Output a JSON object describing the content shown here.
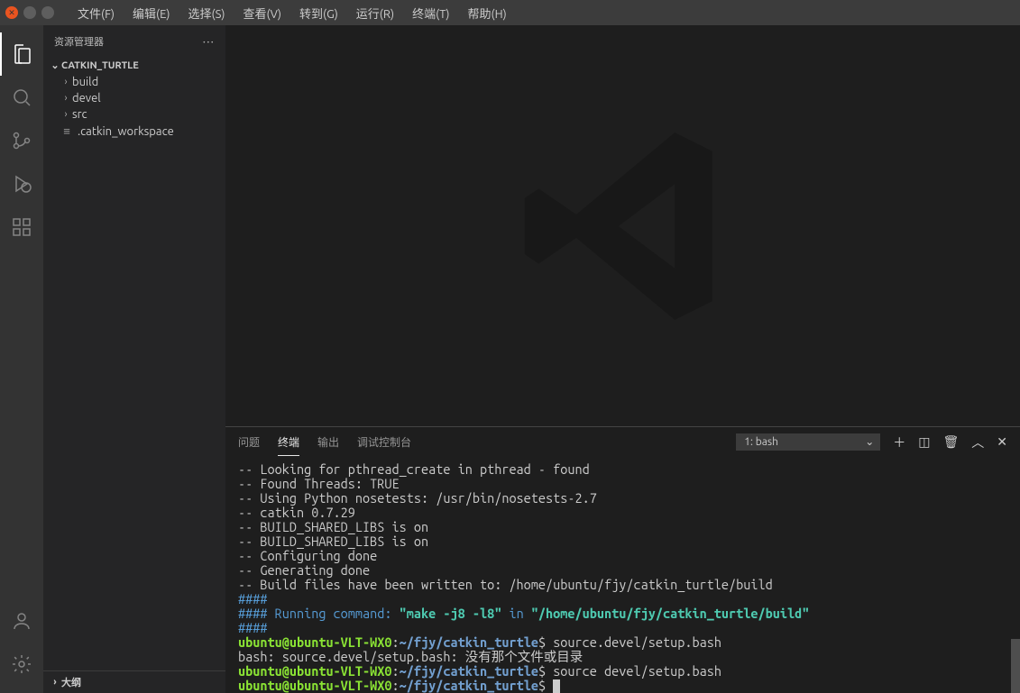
{
  "menu": {
    "file": "文件(F)",
    "edit": "编辑(E)",
    "select": "选择(S)",
    "view": "查看(V)",
    "go": "转到(G)",
    "run": "运行(R)",
    "terminal": "终端(T)",
    "help": "帮助(H)"
  },
  "sidebar": {
    "title": "资源管理器",
    "project": "CATKIN_TURTLE",
    "items": [
      {
        "label": "build"
      },
      {
        "label": "devel"
      },
      {
        "label": "src"
      },
      {
        "label": ".catkin_workspace"
      }
    ],
    "outline": "大纲"
  },
  "panel": {
    "tabs": {
      "problems": "问题",
      "terminal": "终端",
      "output": "输出",
      "debug": "调试控制台"
    },
    "terminalSelect": "1: bash"
  },
  "terminal": {
    "l1": "-- Looking for pthread_create in pthread - found",
    "l2": "-- Found Threads: TRUE",
    "l3": "-- Using Python nosetests: /usr/bin/nosetests-2.7",
    "l4": "-- catkin 0.7.29",
    "l5": "-- BUILD_SHARED_LIBS is on",
    "l6": "-- BUILD_SHARED_LIBS is on",
    "l7": "-- Configuring done",
    "l8": "-- Generating done",
    "l9": "-- Build files have been written to: /home/ubuntu/fjy/catkin_turtle/build",
    "hash": "####",
    "runPrefix": "#### Running command: ",
    "runCmd": "\"make -j8 -l8\"",
    "runIn": " in ",
    "runPath": "\"/home/ubuntu/fjy/catkin_turtle/build\"",
    "promptUser": "ubuntu@ubuntu-VLT-WX0",
    "promptColon": ":",
    "promptPath": "~/fjy/catkin_turtle",
    "promptDollar": "$ ",
    "cmd1": "source.devel/setup.bash",
    "err1": "bash: source.devel/setup.bash: 没有那个文件或目录",
    "cmd2": "source devel/setup.bash"
  }
}
